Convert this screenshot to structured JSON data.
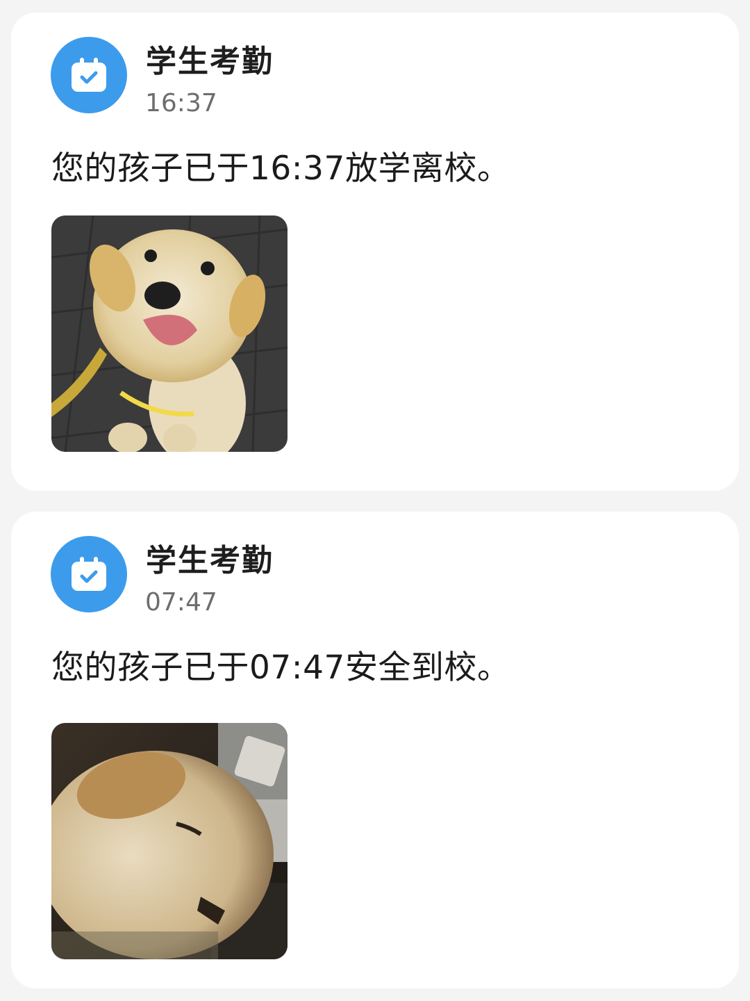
{
  "notifications": [
    {
      "app_name": "学生考勤",
      "time": "16:37",
      "message": "您的孩子已于16:37放学离校。",
      "icon": "calendar-check-icon",
      "photo": "puppy-photo"
    },
    {
      "app_name": "学生考勤",
      "time": "07:47",
      "message": "您的孩子已于07:47安全到校。",
      "icon": "calendar-check-icon",
      "photo": "puppy-photo"
    }
  ],
  "colors": {
    "accent": "#3d9bec",
    "background": "#f4f4f4",
    "card": "#ffffff"
  }
}
